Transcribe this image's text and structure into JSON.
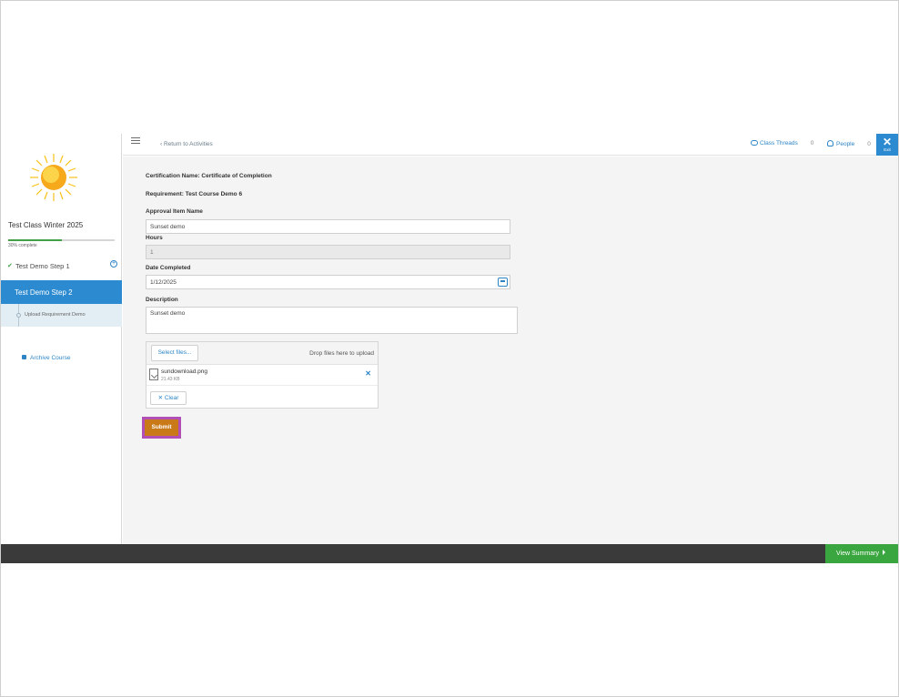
{
  "sidebar": {
    "class_title": "Test Class Winter 2025",
    "progress_text": "30% complete",
    "progress_fraction": 0.5,
    "steps": [
      {
        "label": "Test Demo Step 1",
        "completed": true
      },
      {
        "label": "Test Demo Step 2",
        "active": true
      }
    ],
    "substep_label": "Upload Requirement Demo",
    "archive_label": "Archive Course"
  },
  "topbar": {
    "return_label": "‹ Return to Activities",
    "class_threads_label": "Class Threads",
    "class_threads_count": "0",
    "people_label": "People",
    "people_count": "0",
    "exit_label": "Exit"
  },
  "form": {
    "certification_name": "Certification Name: Certificate of Completion",
    "requirement": "Requirement: Test Course Demo 6",
    "approval_item_label": "Approval Item Name",
    "approval_item_value": "Sunset demo",
    "hours_label": "Hours",
    "hours_value": "1",
    "date_label": "Date Completed",
    "date_value": "1/12/2025",
    "description_label": "Description",
    "description_value": "Sunset demo",
    "select_files_label": "Select files...",
    "drop_files_text": "Drop files here to upload",
    "file_name": "sundownload.png",
    "file_size": "21.43 KB",
    "clear_label": "Clear",
    "submit_label": "Submit"
  },
  "footer": {
    "view_summary_label": "View Summary"
  },
  "colors": {
    "primary_blue": "#2b8ad0",
    "progress_green": "#43a047",
    "submit_orange": "#c97917",
    "highlight_magenta": "#b24fb7",
    "summary_green": "#3aa63f"
  }
}
